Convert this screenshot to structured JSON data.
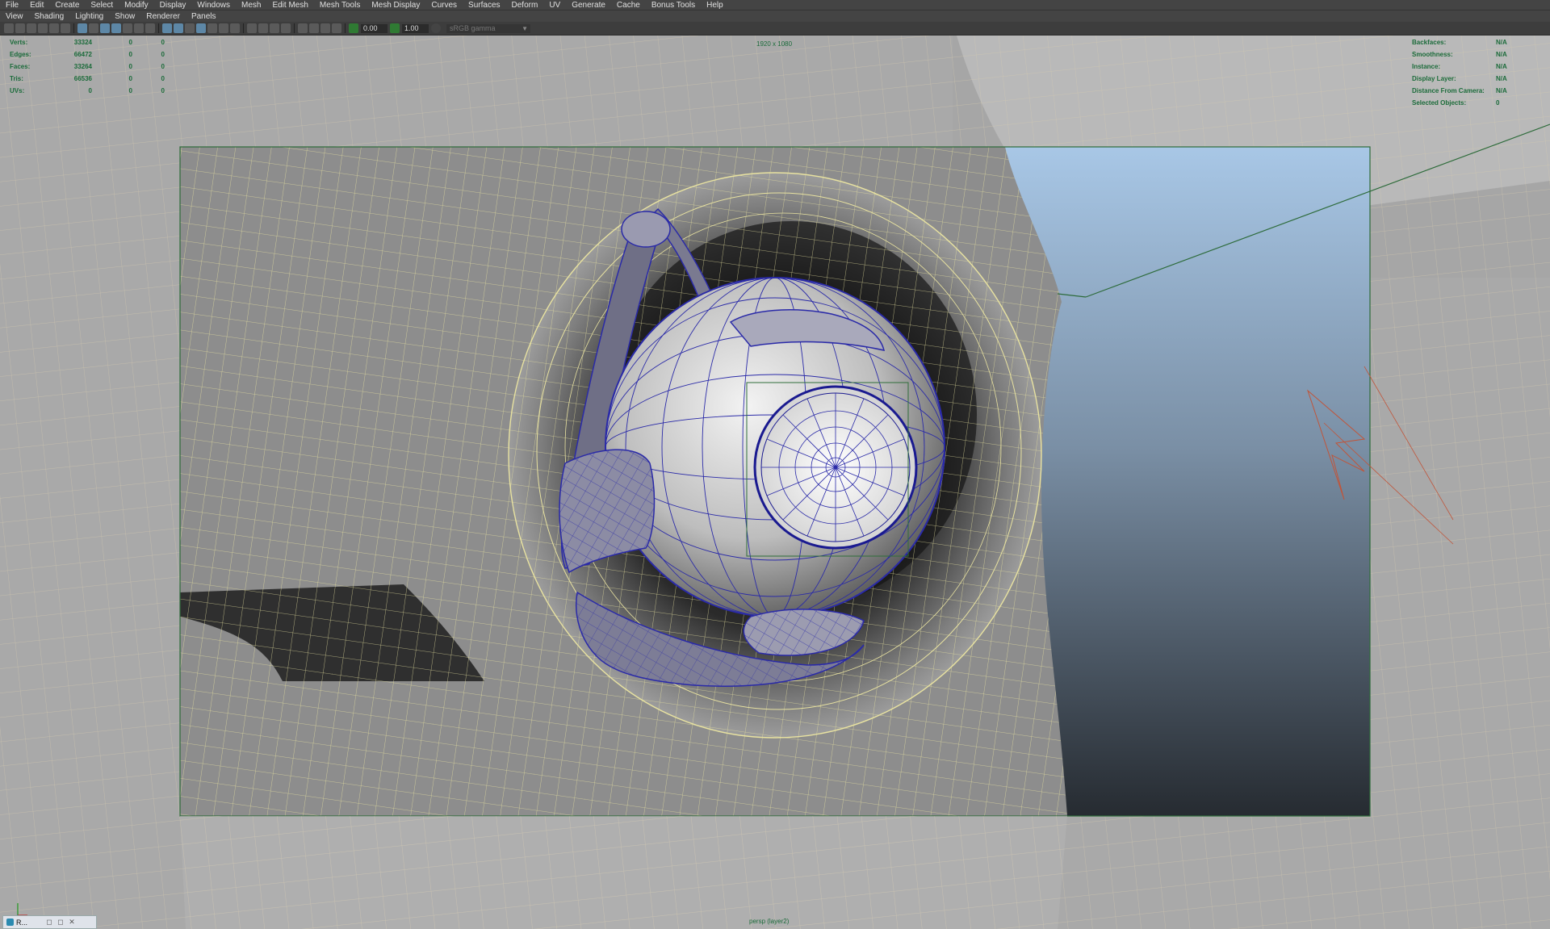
{
  "menubar": [
    "File",
    "Edit",
    "Create",
    "Select",
    "Modify",
    "Display",
    "Windows",
    "Mesh",
    "Edit Mesh",
    "Mesh Tools",
    "Mesh Display",
    "Curves",
    "Surfaces",
    "Deform",
    "UV",
    "Generate",
    "Cache",
    "Bonus Tools",
    "Help"
  ],
  "panel_menu": [
    "View",
    "Shading",
    "Lighting",
    "Show",
    "Renderer",
    "Panels"
  ],
  "toolbar": {
    "exposure_value": "0.00",
    "gamma_value": "1.00",
    "color_space": "sRGB gamma"
  },
  "hud_left": [
    {
      "label": "Verts:",
      "v1": "33324",
      "v2": "0",
      "v3": "0"
    },
    {
      "label": "Edges:",
      "v1": "66472",
      "v2": "0",
      "v3": "0"
    },
    {
      "label": "Faces:",
      "v1": "33264",
      "v2": "0",
      "v3": "0"
    },
    {
      "label": "Tris:",
      "v1": "66536",
      "v2": "0",
      "v3": "0"
    },
    {
      "label": "UVs:",
      "v1": "0",
      "v2": "0",
      "v3": "0"
    }
  ],
  "hud_right": [
    {
      "label": "Backfaces:",
      "value": "N/A"
    },
    {
      "label": "Smoothness:",
      "value": "N/A"
    },
    {
      "label": "Instance:",
      "value": "N/A"
    },
    {
      "label": "Display Layer:",
      "value": "N/A"
    },
    {
      "label": "Distance From Camera:",
      "value": "N/A"
    },
    {
      "label": "Selected Objects:",
      "value": "0"
    }
  ],
  "resolution_gate": "1920 x 1080",
  "camera_label": "persp (layer2)",
  "taskbar": {
    "label": "R...",
    "controls": [
      "◻",
      "◻",
      "✕"
    ]
  },
  "colors": {
    "hud_text": "#1b6b3a",
    "wire_yellow": "#e8e2a0",
    "wire_blue": "#2a2aa8",
    "background_top": "#a8c7e6",
    "background_bottom": "#2a2f36"
  }
}
